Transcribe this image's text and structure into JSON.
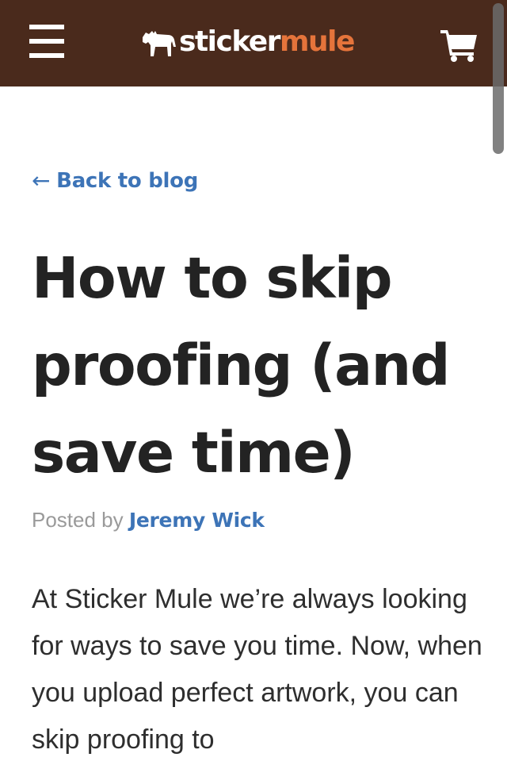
{
  "header": {
    "logo_left": "sticker",
    "logo_right": "mule",
    "icons": [
      "menu-icon",
      "mule-logo-icon",
      "cart-icon"
    ]
  },
  "nav": {
    "back_arrow": "←",
    "back_label": "Back to blog"
  },
  "post": {
    "title": "How to skip proofing (and save time)",
    "posted_by_label": "Posted by",
    "author": "Jeremy Wick",
    "body": "At Sticker Mule we’re always looking for ways to save you time. Now, when you upload perfect artwork, you can skip proofing to"
  },
  "colors": {
    "header_bg": "#4a2a1c",
    "link": "#3d74b7",
    "logo_accent": "#e5743b"
  }
}
